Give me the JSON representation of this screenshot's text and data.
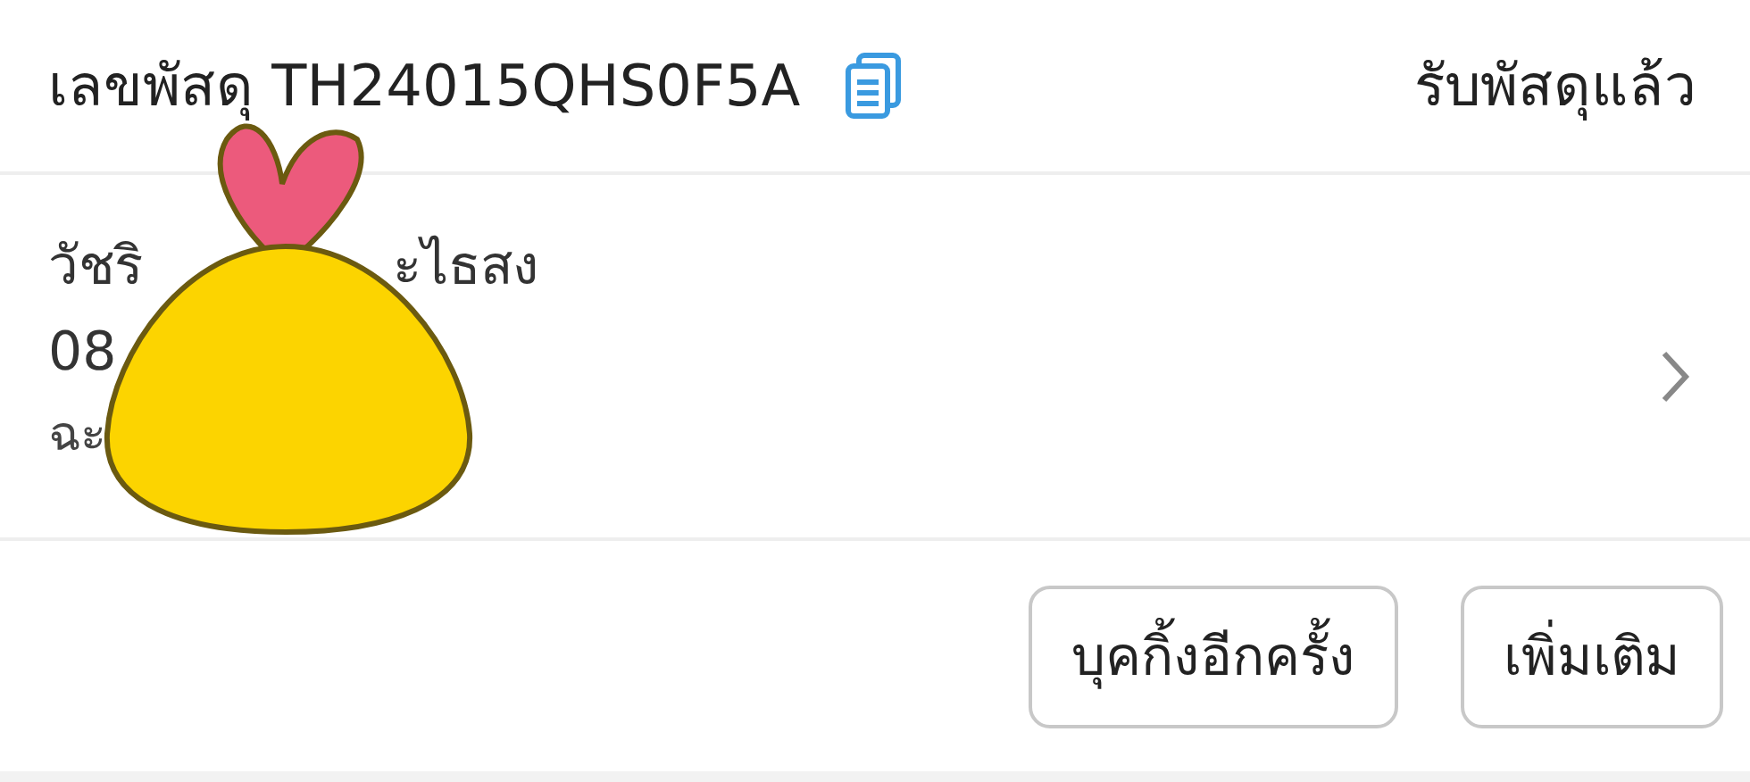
{
  "header": {
    "tracking": "เลขพัสดุ TH24015QHS0F5A",
    "status": "รับพัสดุแล้ว"
  },
  "recipient": {
    "name_parts": [
      "วัชริ",
      "ะไธสง"
    ],
    "phone": "08",
    "address": "ฉะ"
  },
  "buttons": [
    "บุคกิ้งอีกครั้ง",
    "เพิ่มเติม"
  ]
}
